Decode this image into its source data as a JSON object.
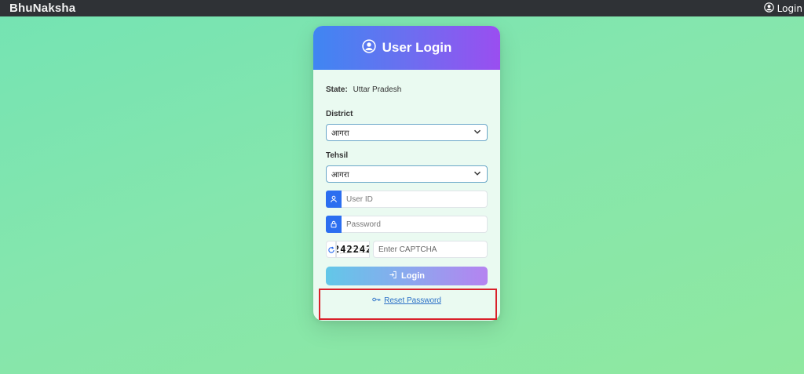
{
  "topbar": {
    "brand": "BhuNaksha",
    "login_label": "Login",
    "login_icon": "user-circle-icon"
  },
  "login_card": {
    "title": "User Login",
    "title_icon": "user-circle-icon",
    "state_label": "State:",
    "state_value": "Uttar Pradesh",
    "district_label": "District",
    "district_selected": "आगरा",
    "tehsil_label": "Tehsil",
    "tehsil_selected": "आगरा",
    "userid_placeholder": "User ID",
    "userid_icon": "user-icon",
    "password_placeholder": "Password",
    "password_icon": "lock-icon",
    "captcha_refresh_icon": "refresh-icon",
    "captcha_code": "242242",
    "captcha_placeholder": "Enter CAPTCHA",
    "login_button_label": "Login",
    "login_button_icon": "sign-in-icon",
    "reset_icon": "key-icon",
    "reset_label": "Reset Password"
  },
  "colors": {
    "topbar_bg": "#2f3236",
    "header_gradient_start": "#3f86f2",
    "header_gradient_end": "#9a4ef0",
    "input_icon_bg": "#2b6ef0",
    "link_color": "#2a6fc7",
    "highlight_border": "#d9202a"
  }
}
